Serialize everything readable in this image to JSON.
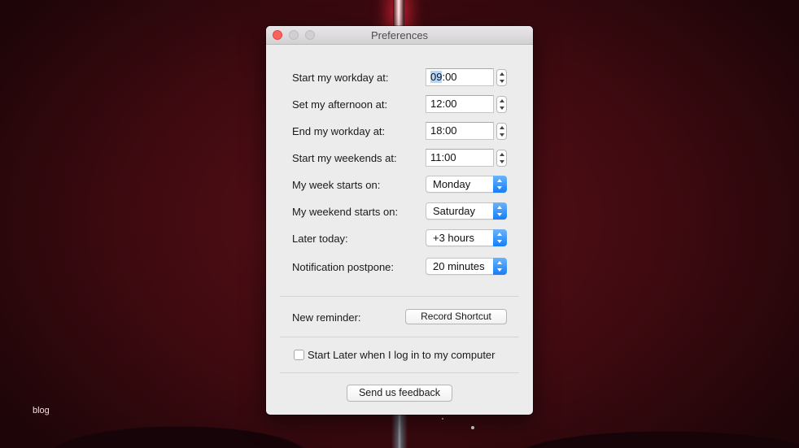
{
  "desktop": {
    "blog_label": "blog"
  },
  "window": {
    "title": "Preferences",
    "rows": [
      {
        "label": "Start my workday at:",
        "value_hl": "09",
        "value_rest": ":00"
      },
      {
        "label": "Set my afternoon at:",
        "value": "12:00"
      },
      {
        "label": "End my workday at:",
        "value": "18:00"
      },
      {
        "label": "Start my weekends at:",
        "value": "11:00"
      },
      {
        "label": "My week starts on:",
        "value": "Monday"
      },
      {
        "label": "My weekend starts on:",
        "value": "Saturday"
      },
      {
        "label": "Later today:",
        "value": "+3 hours"
      },
      {
        "label": "Notification postpone:",
        "value": "20 minutes"
      }
    ],
    "shortcut": {
      "label": "New reminder:",
      "button": "Record Shortcut"
    },
    "login_checkbox": {
      "label": "Start Later when I log in to my computer",
      "checked": false
    },
    "feedback_button": "Send us feedback"
  },
  "colors": {
    "accent": "#157ef9",
    "close_button": "#fc605c",
    "selection": "#b3d6fd"
  }
}
